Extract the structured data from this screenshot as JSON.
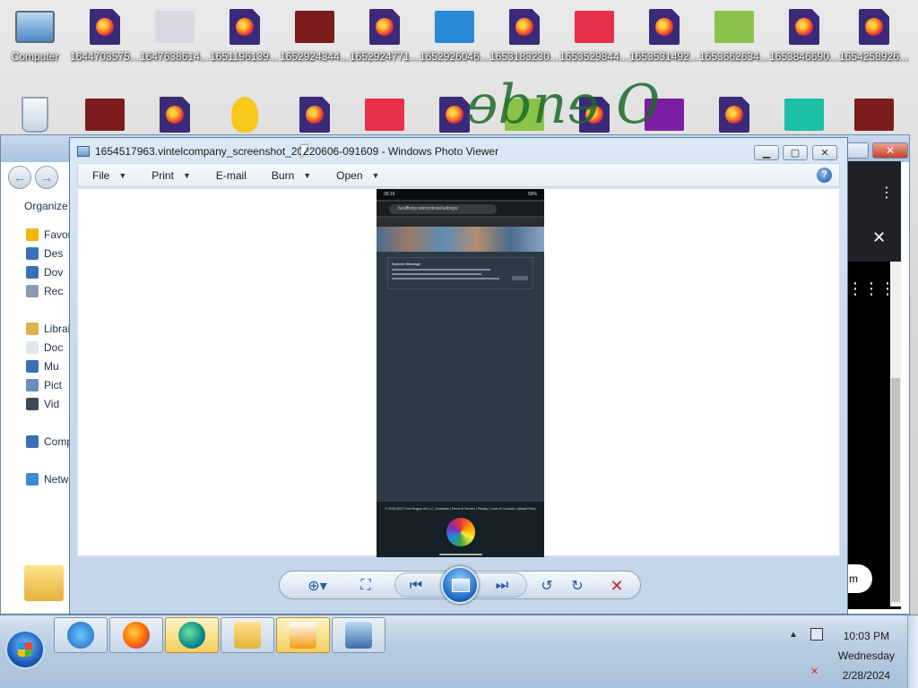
{
  "desktop": {
    "row1": [
      {
        "label": "Computer",
        "icon": "computer-icon"
      },
      {
        "label": "1644703575....",
        "icon": "firefox-document-icon"
      },
      {
        "label": "1647638614....",
        "icon": "image-thumbnail-icon"
      },
      {
        "label": "1651196139....",
        "icon": "firefox-document-icon"
      },
      {
        "label": "1652924344....",
        "icon": "image-thumbnail-icon"
      },
      {
        "label": "1652924771....",
        "icon": "firefox-document-icon"
      },
      {
        "label": "1652926046....",
        "icon": "image-thumbnail-icon"
      },
      {
        "label": "1653183230....",
        "icon": "firefox-document-icon"
      },
      {
        "label": "1653529844....",
        "icon": "image-thumbnail-icon"
      },
      {
        "label": "1653531492....",
        "icon": "firefox-document-icon"
      },
      {
        "label": "1653662634....",
        "icon": "image-thumbnail-icon"
      },
      {
        "label": "1653846690....",
        "icon": "firefox-document-icon"
      },
      {
        "label": "1654258926....",
        "icon": "firefox-document-icon"
      }
    ],
    "row2_icons": [
      "recycle-bin-icon",
      "image-thumbnail-icon",
      "firefox-document-icon",
      "duck-icon",
      "firefox-document-icon",
      "image-thumbnail-icon",
      "firefox-document-icon",
      "image-thumbnail-icon",
      "firefox-document-icon",
      "image-thumbnail-icon",
      "firefox-document-icon",
      "image-thumbnail-icon",
      "image-thumbnail-icon"
    ]
  },
  "explorer": {
    "organize": "Organize",
    "sidebar": [
      {
        "label": "Favor",
        "icon": "star-icon"
      },
      {
        "label": "Des",
        "icon": "desktop-icon"
      },
      {
        "label": "Dov",
        "icon": "downloads-icon"
      },
      {
        "label": "Rec",
        "icon": "recent-icon"
      },
      {
        "label": "Librai",
        "icon": "libraries-icon"
      },
      {
        "label": "Doc",
        "icon": "documents-icon"
      },
      {
        "label": "Mu",
        "icon": "music-icon"
      },
      {
        "label": "Pict",
        "icon": "pictures-icon"
      },
      {
        "label": "Vid",
        "icon": "videos-icon"
      },
      {
        "label": "Comp",
        "icon": "computer-icon"
      },
      {
        "label": "Netw",
        "icon": "network-icon"
      }
    ],
    "right_button_text": "m"
  },
  "viewer": {
    "title": "1654517963.vintelcompany_screenshot_20220606-091609 - Windows Photo Viewer",
    "menu": [
      {
        "label": "File",
        "has_dropdown": true
      },
      {
        "label": "Print",
        "has_dropdown": true
      },
      {
        "label": "E-mail",
        "has_dropdown": false
      },
      {
        "label": "Burn",
        "has_dropdown": true
      },
      {
        "label": "Open",
        "has_dropdown": true
      }
    ],
    "help": "?",
    "image": {
      "status_time": "09:16",
      "status_battery": "58%",
      "url": "furaffinity.net/controls/settings/",
      "message_title": "System Message",
      "footer_text": "© 2005-2022 Frost Dragon Art LLC | Advertise | Terms of Service | Privacy | Code of Conduct | Upload Policy"
    },
    "controls": [
      {
        "name": "zoom",
        "icon": "zoom-icon"
      },
      {
        "name": "actual-size",
        "icon": "fit-window-icon"
      },
      {
        "name": "previous",
        "icon": "previous-icon"
      },
      {
        "name": "slideshow",
        "icon": "slideshow-icon"
      },
      {
        "name": "next",
        "icon": "next-icon"
      },
      {
        "name": "rotate-ccw",
        "icon": "rotate-counterclockwise-icon"
      },
      {
        "name": "rotate-cw",
        "icon": "rotate-clockwise-icon"
      },
      {
        "name": "delete",
        "icon": "delete-icon"
      }
    ]
  },
  "taskbar": {
    "apps": [
      "internet-explorer-icon",
      "firefox-icon",
      "edge-icon",
      "file-explorer-icon",
      "media-player-icon",
      "photo-viewer-icon"
    ],
    "active_apps": [
      "edge-icon",
      "media-player-icon"
    ],
    "clock": {
      "time": "10:03 PM",
      "day": "Wednesday",
      "date": "2/28/2024"
    }
  },
  "colors": {
    "accent": "#1c64c2",
    "title_bar": "#c9dbee",
    "delete": "#c62828",
    "taskbar": "#b9cde2"
  }
}
